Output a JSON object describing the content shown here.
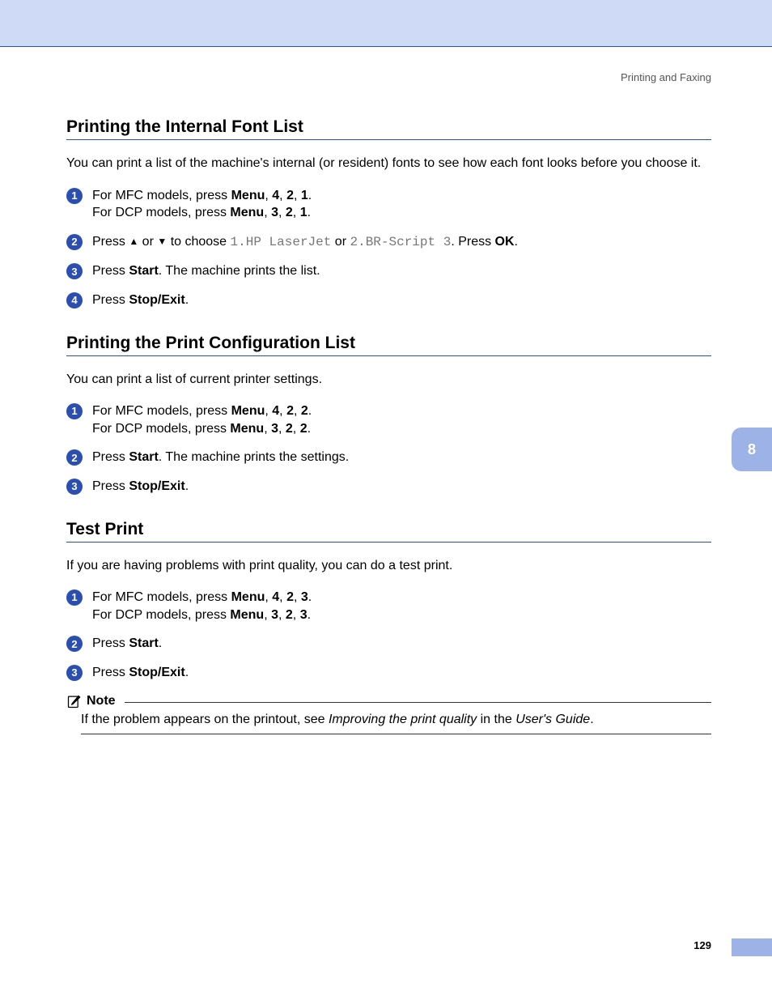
{
  "header": {
    "section_label": "Printing and Faxing"
  },
  "side_tab": {
    "chapter": "8"
  },
  "page": {
    "number": "129"
  },
  "sections": {
    "s1": {
      "title": "Printing the Internal Font List",
      "intro": "You can print a list of the machine's internal (or resident) fonts to see how each font looks before you choose it.",
      "steps": {
        "a": {
          "mfc_prefix": "For MFC models, press ",
          "mfc_menu": "Menu",
          "mfc_k1": "4",
          "mfc_k2": "2",
          "mfc_k3": "1",
          "dcp_prefix": "For DCP models, press ",
          "dcp_menu": "Menu",
          "dcp_k1": "3",
          "dcp_k2": "2",
          "dcp_k3": "1"
        },
        "b": {
          "t1": "Press ",
          "t2": " or ",
          "t3": " to choose ",
          "opt1": "1.HP LaserJet",
          "t4": " or ",
          "opt2": "2.BR-Script 3",
          "t5": ". Press ",
          "ok": "OK",
          "t6": "."
        },
        "c": {
          "t1": "Press ",
          "start": "Start",
          "t2": ". The machine prints the list."
        },
        "d": {
          "t1": "Press ",
          "stop": "Stop/Exit",
          "t2": "."
        }
      }
    },
    "s2": {
      "title": "Printing the Print Configuration List",
      "intro": "You can print a list of current printer settings.",
      "steps": {
        "a": {
          "mfc_prefix": "For MFC models, press ",
          "mfc_menu": "Menu",
          "mfc_k1": "4",
          "mfc_k2": "2",
          "mfc_k3": "2",
          "dcp_prefix": "For DCP models, press ",
          "dcp_menu": "Menu",
          "dcp_k1": "3",
          "dcp_k2": "2",
          "dcp_k3": "2"
        },
        "b": {
          "t1": "Press ",
          "start": "Start",
          "t2": ". The machine prints the settings."
        },
        "c": {
          "t1": "Press ",
          "stop": "Stop/Exit",
          "t2": "."
        }
      }
    },
    "s3": {
      "title": "Test Print",
      "intro": "If you are having problems with print quality, you can do a test print.",
      "steps": {
        "a": {
          "mfc_prefix": "For MFC models, press ",
          "mfc_menu": "Menu",
          "mfc_k1": "4",
          "mfc_k2": "2",
          "mfc_k3": "3",
          "dcp_prefix": "For DCP models, press ",
          "dcp_menu": "Menu",
          "dcp_k1": "3",
          "dcp_k2": "2",
          "dcp_k3": "3"
        },
        "b": {
          "t1": "Press ",
          "start": "Start",
          "t2": "."
        },
        "c": {
          "t1": "Press ",
          "stop": "Stop/Exit",
          "t2": "."
        }
      },
      "note": {
        "label": "Note",
        "t1": "If the problem appears on the printout, see ",
        "link": "Improving the print quality",
        "t2": " in the ",
        "guide": "User's Guide",
        "t3": "."
      }
    }
  }
}
